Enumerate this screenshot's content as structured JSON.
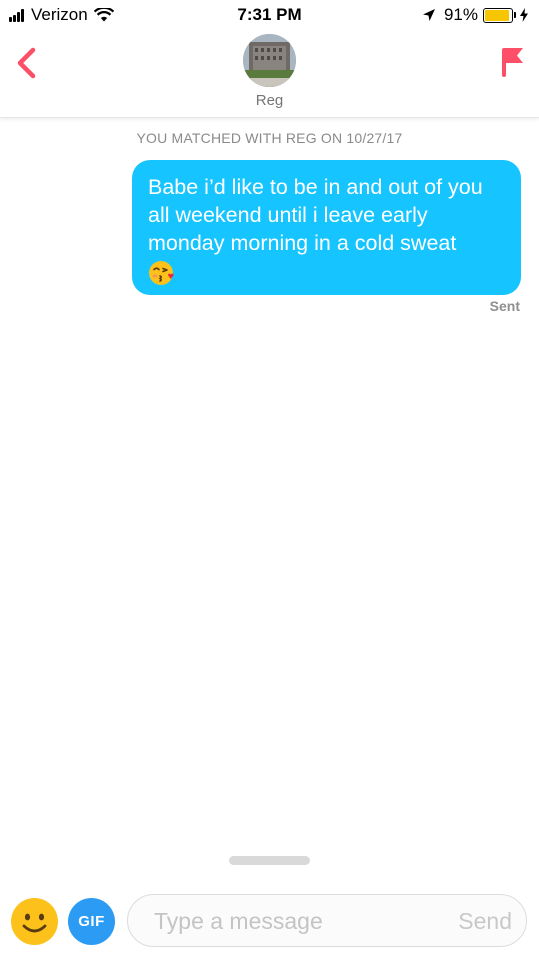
{
  "status_bar": {
    "carrier": "Verizon",
    "time": "7:31 PM",
    "battery": "91%",
    "battery_level": 0.91,
    "icons": [
      "signal-icon",
      "wifi-icon",
      "location-arrow-icon",
      "battery-icon",
      "charging-bolt-icon"
    ]
  },
  "header": {
    "back_icon": "chevron-left-icon",
    "match_name": "Reg",
    "report_icon": "flag-icon"
  },
  "conversation": {
    "match_date": "YOU MATCHED WITH REG ON 10/27/17",
    "messages": [
      {
        "text": "Babe i’d like to be in and out of you all weekend until i leave early monday morning in a cold sweat",
        "emoji": "kissing-face-icon",
        "status": "Sent"
      }
    ]
  },
  "composer": {
    "emoji_icon": "smiley-face-icon",
    "gif_label": "GIF",
    "placeholder": "Type a message",
    "value": "",
    "send_label": "Send"
  },
  "colors": {
    "accent": "#fd5068",
    "bubble": "#16c5ff",
    "gif_button": "#2b9bf4",
    "battery_fill": "#f7c600"
  }
}
